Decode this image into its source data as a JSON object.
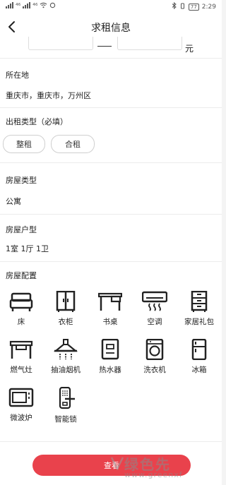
{
  "status_bar": {
    "signal_left": "⁴⁶",
    "signal_right": "⁴⁶",
    "battery": "77",
    "time": "2:29"
  },
  "header": {
    "title": "求租信息",
    "back_icon": "chevron-left-icon"
  },
  "price_range": {
    "unit": "元"
  },
  "location": {
    "label": "所在地",
    "value": "重庆市，重庆市，万州区"
  },
  "rental_type": {
    "label": "出租类型（必填）",
    "options": [
      "整租",
      "合租"
    ]
  },
  "house_type": {
    "label": "房屋类型",
    "value": "公寓"
  },
  "layout": {
    "label": "房屋户型",
    "value": "1室 1厅 1卫"
  },
  "config": {
    "label": "房屋配置",
    "items": [
      {
        "label": "床",
        "icon": "bed-icon"
      },
      {
        "label": "衣柜",
        "icon": "wardrobe-icon"
      },
      {
        "label": "书桌",
        "icon": "desk-icon"
      },
      {
        "label": "空调",
        "icon": "air-conditioner-icon"
      },
      {
        "label": "家居礼包",
        "icon": "cabinet-icon"
      },
      {
        "label": "燃气灶",
        "icon": "gas-stove-icon"
      },
      {
        "label": "抽油烟机",
        "icon": "range-hood-icon"
      },
      {
        "label": "热水器",
        "icon": "water-heater-icon"
      },
      {
        "label": "洗衣机",
        "icon": "washing-machine-icon"
      },
      {
        "label": "冰箱",
        "icon": "fridge-icon"
      },
      {
        "label": "微波炉",
        "icon": "microwave-icon"
      },
      {
        "label": "智能锁",
        "icon": "smart-lock-icon"
      }
    ]
  },
  "footer": {
    "view_button": "查看"
  },
  "watermark": {
    "text_cn": "绿色先",
    "text_en": "www.greenxf"
  },
  "colors": {
    "accent": "#e9424c",
    "divider": "#ececec"
  }
}
